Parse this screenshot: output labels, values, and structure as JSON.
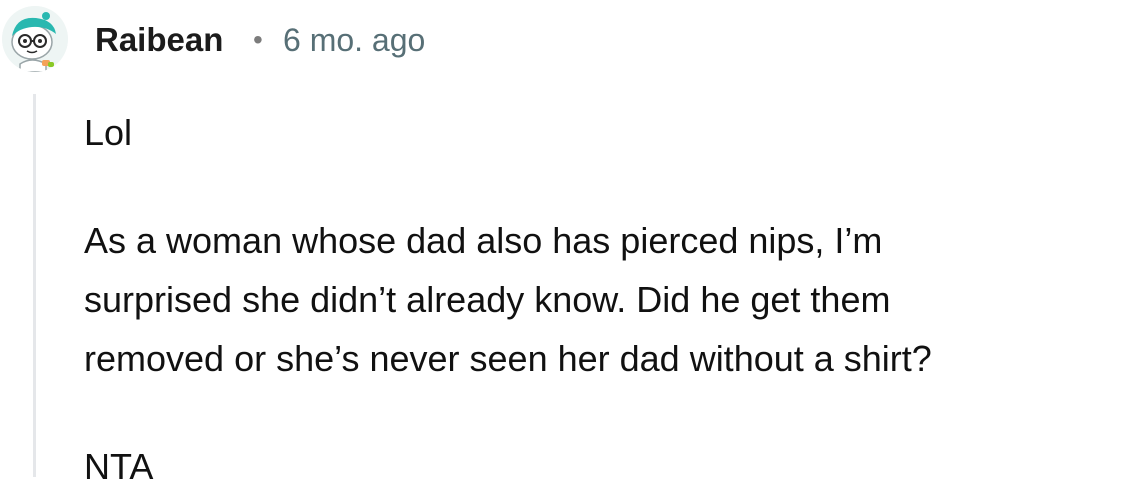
{
  "comment": {
    "author": "Raibean",
    "separator": "•",
    "timestamp": "6 mo. ago",
    "avatar_icon": "snoo-avatar-icon",
    "paragraphs": [
      "Lol",
      "As a woman whose dad also has pierced nips, I’m\nsurprised she didn’t already know. Did he get them\nremoved or she’s never seen her dad without a shirt?",
      "NTA"
    ]
  },
  "colors": {
    "background": "#ffffff",
    "author": "#1c1c1c",
    "timestamp": "#576f76",
    "thread_line": "#e5e7ea",
    "avatar_accent": "#29b8b0"
  }
}
